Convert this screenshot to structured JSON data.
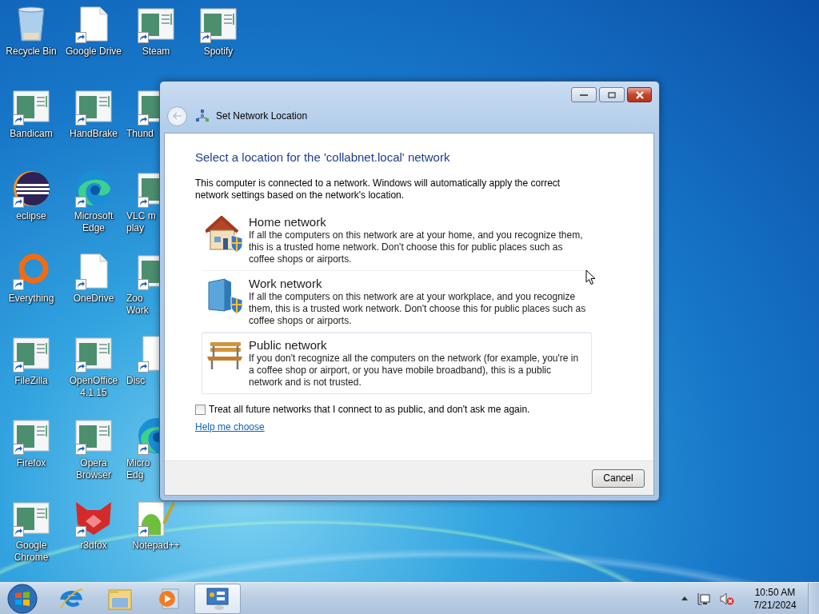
{
  "desktop": {
    "icons": [
      {
        "label": "Recycle Bin",
        "kind": "recycle-bin",
        "shortcut": false
      },
      {
        "label": "Bandicam",
        "kind": "app-window",
        "shortcut": true
      },
      {
        "label": "eclipse",
        "kind": "eclipse",
        "shortcut": true
      },
      {
        "label": "Everything",
        "kind": "everything",
        "shortcut": true
      },
      {
        "label": "FileZilla",
        "kind": "app-window",
        "shortcut": true
      },
      {
        "label": "Firefox",
        "kind": "app-window",
        "shortcut": true
      },
      {
        "label": "Google Chrome",
        "kind": "app-window",
        "shortcut": true
      },
      {
        "label": "Google Drive",
        "kind": "document",
        "shortcut": true
      },
      {
        "label": "HandBrake",
        "kind": "app-window",
        "shortcut": true
      },
      {
        "label": "Microsoft Edge",
        "kind": "edge",
        "shortcut": true
      },
      {
        "label": "OneDrive",
        "kind": "document",
        "shortcut": true
      },
      {
        "label": "OpenOffice 4.1.15",
        "kind": "app-window",
        "shortcut": true
      },
      {
        "label": "Opera Browser",
        "kind": "app-window",
        "shortcut": true
      },
      {
        "label": "r3dfox",
        "kind": "fox",
        "shortcut": true
      },
      {
        "label": "Steam",
        "kind": "app-window",
        "shortcut": true
      },
      {
        "label": "Thund",
        "kind": "app-window",
        "shortcut": true
      },
      {
        "label": "VLC m play",
        "kind": "app-window",
        "shortcut": true
      },
      {
        "label": "Zoo Work",
        "kind": "app-window",
        "shortcut": true
      },
      {
        "label": "Disc",
        "kind": "document",
        "shortcut": true
      },
      {
        "label": "Micro Edg",
        "kind": "edge",
        "shortcut": true
      },
      {
        "label": "Notepad++",
        "kind": "notepad",
        "shortcut": true
      },
      {
        "label": "Spotify",
        "kind": "app-window",
        "shortcut": true
      }
    ]
  },
  "window": {
    "title": "Set Network Location",
    "heading": "Select a location for the 'collabnet.local' network",
    "intro": "This computer is connected to a network. Windows will automatically apply the correct network settings based on the network's location.",
    "options": [
      {
        "kind": "home",
        "title": "Home network",
        "description": "If all the computers on this network are at your home, and you recognize them, this is a trusted home network.  Don't choose this for public places such as coffee shops or airports.",
        "selected": false
      },
      {
        "kind": "work",
        "title": "Work network",
        "description": "If all the computers on this network are at your workplace, and you recognize them, this is a trusted work network.  Don't choose this for public places such as coffee shops or airports.",
        "selected": false
      },
      {
        "kind": "public",
        "title": "Public network",
        "description": "If you don't recognize all the computers on the network (for example, you're in a coffee shop or airport, or you have mobile broadband), this is a public network and is not trusted.",
        "selected": true
      }
    ],
    "checkbox": {
      "label": "Treat all future networks that I connect to as public, and don't ask me again.",
      "checked": false
    },
    "help_link": "Help me choose",
    "buttons": [
      "Cancel"
    ]
  },
  "taskbar": {
    "pinned": [
      {
        "kind": "internet-explorer",
        "active": false
      },
      {
        "kind": "file-explorer",
        "active": false
      },
      {
        "kind": "media-player",
        "active": false
      },
      {
        "kind": "network-settings",
        "active": true
      }
    ],
    "clock": {
      "time": "10:50 AM",
      "date": "7/21/2024"
    }
  }
}
